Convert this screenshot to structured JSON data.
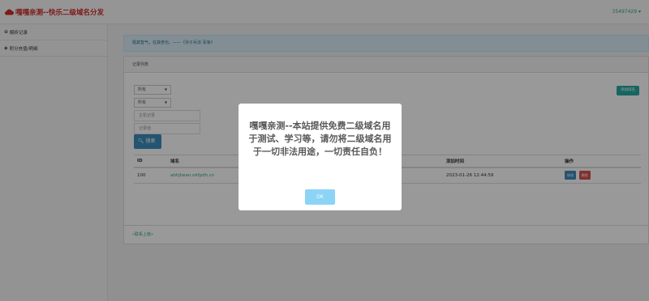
{
  "header": {
    "brand": "嘎嘎亲测--快乐二级域名分发",
    "user": "35497429 ▾"
  },
  "sidebar": {
    "items": [
      {
        "icon": "globe-icon",
        "label": "解析记录"
      },
      {
        "icon": "shield-icon",
        "label": "积分充值/明细"
      }
    ]
  },
  "alert": {
    "text": "题其智气，在其修也。——《孙子兵法·军争》"
  },
  "panel": {
    "title": "记录列表",
    "add_label": "添加域名",
    "filters": [
      {
        "value": "所有"
      },
      {
        "value": "所有"
      }
    ],
    "inputs": [
      {
        "placeholder": "主机记录"
      },
      {
        "placeholder": "记录值"
      }
    ],
    "search_label": "搜索"
  },
  "table": {
    "headers": [
      "ID",
      "域名",
      "",
      "添加时间",
      "操作"
    ],
    "rows": [
      {
        "id": "100",
        "domain": "abhjtwan.okfpdh.cn",
        "time": "2023-01-26 12:44:59",
        "edit": "修改",
        "delete": "删除"
      }
    ]
  },
  "footer": {
    "text": "«联系上级»"
  },
  "modal": {
    "message": "嘎嘎亲测--本站提供免费二级域名用于测试、学习等，请勿将二级域名用于一切非法用途，一切责任自负！",
    "ok_label": "OK"
  },
  "colors": {
    "brand": "#d22b2b",
    "primary": "#3c8dbc",
    "danger": "#d9534f",
    "success": "#27a9a0",
    "modal_button": "#8cd4f5"
  }
}
